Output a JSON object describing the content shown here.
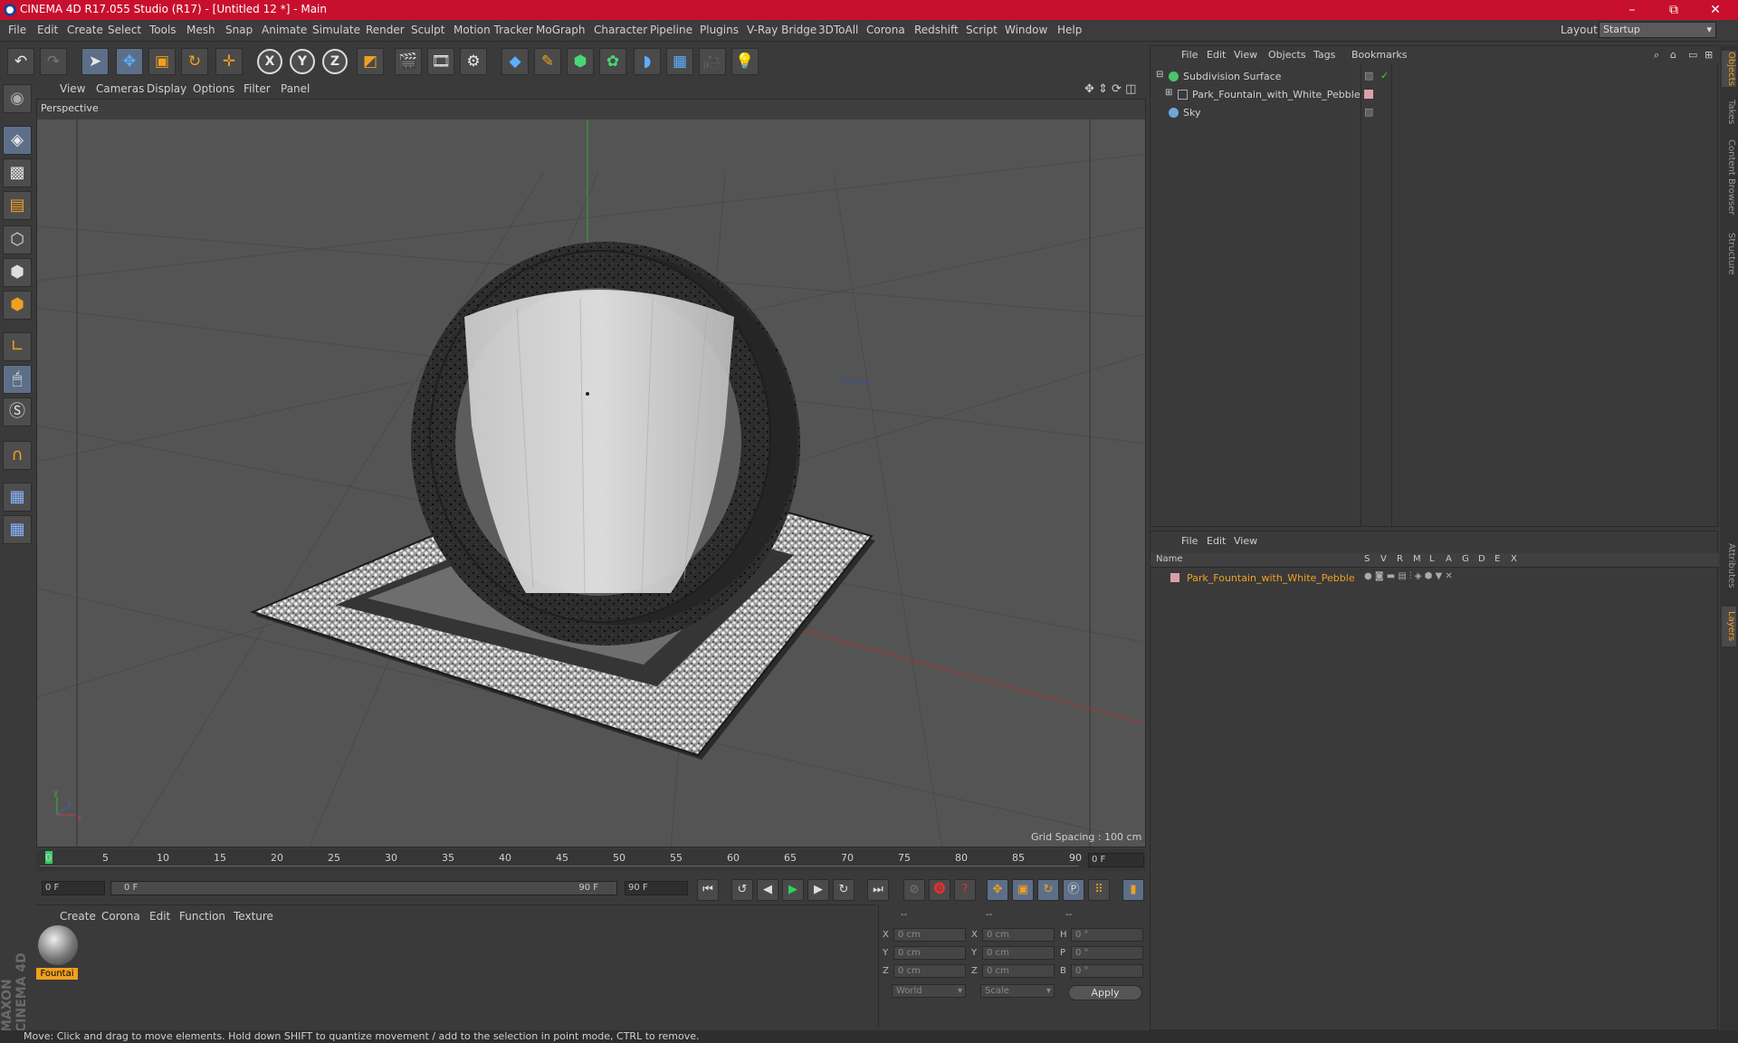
{
  "title": "CINEMA 4D R17.055 Studio (R17) - [Untitled 12 *] - Main",
  "window_controls": [
    "–",
    "⧉",
    "✕"
  ],
  "menu": [
    "File",
    "Edit",
    "Create",
    "Select",
    "Tools",
    "Mesh",
    "Snap",
    "Animate",
    "Simulate",
    "Render",
    "Sculpt",
    "Motion Tracker",
    "MoGraph",
    "Character",
    "Pipeline",
    "Plugins",
    "V-Ray Bridge",
    "3DToAll",
    "Corona",
    "Redshift",
    "Script",
    "Window",
    "Help"
  ],
  "layout": {
    "label": "Layout:",
    "value": "Startup"
  },
  "viewport": {
    "menu": [
      "View",
      "Cameras",
      "Display",
      "Options",
      "Filter",
      "Panel"
    ],
    "label": "Perspective",
    "grid_spacing": "Grid Spacing : 100 cm"
  },
  "timeline": {
    "ticks": [
      "0",
      "5",
      "10",
      "15",
      "20",
      "25",
      "30",
      "35",
      "40",
      "45",
      "50",
      "55",
      "60",
      "65",
      "70",
      "75",
      "80",
      "85",
      "90"
    ],
    "current_frame": "0 F",
    "start_field": "0 F",
    "range_start": "0 F",
    "range_end": "90 F",
    "end_field": "90 F"
  },
  "material_manager": {
    "menu": [
      "Create",
      "Corona",
      "Edit",
      "Function",
      "Texture"
    ],
    "material_name": "Fountai"
  },
  "coordinates": {
    "headers": [
      "--",
      "--",
      "--"
    ],
    "rows": [
      {
        "axis1": "X",
        "v1": "0 cm",
        "axis2": "X",
        "v2": "0 cm",
        "axis3": "H",
        "v3": "0 °"
      },
      {
        "axis1": "Y",
        "v1": "0 cm",
        "axis2": "Y",
        "v2": "0 cm",
        "axis3": "P",
        "v3": "0 °"
      },
      {
        "axis1": "Z",
        "v1": "0 cm",
        "axis2": "Z",
        "v2": "0 cm",
        "axis3": "B",
        "v3": "0 °"
      }
    ],
    "mode1": "World",
    "mode2": "Scale",
    "apply": "Apply"
  },
  "object_manager": {
    "menu": [
      "File",
      "Edit",
      "View",
      "Objects",
      "Tags",
      "Bookmarks"
    ],
    "objects": [
      {
        "name": "Subdivision Surface",
        "icon_color": "#4ac46a"
      },
      {
        "name": "Park_Fountain_with_White_Pebble",
        "icon_color": "#8899aa"
      },
      {
        "name": "Sky",
        "icon_color": "#6fa8d8"
      }
    ]
  },
  "layer_manager": {
    "menu": [
      "File",
      "Edit",
      "View"
    ],
    "columns": [
      "Name",
      "S",
      "V",
      "R",
      "M",
      "L",
      "A",
      "G",
      "D",
      "E",
      "X"
    ],
    "layers": [
      {
        "name": "Park_Fountain_with_White_Pebble",
        "color": "#f0a020"
      }
    ]
  },
  "right_tabs": [
    "Objects",
    "Takes",
    "Content Browser",
    "Structure",
    "Attributes",
    "Layers"
  ],
  "brand": "MAXON CINEMA 4D",
  "status": "Move: Click and drag to move elements. Hold down SHIFT to quantize movement / add to the selection in point mode, CTRL to remove."
}
